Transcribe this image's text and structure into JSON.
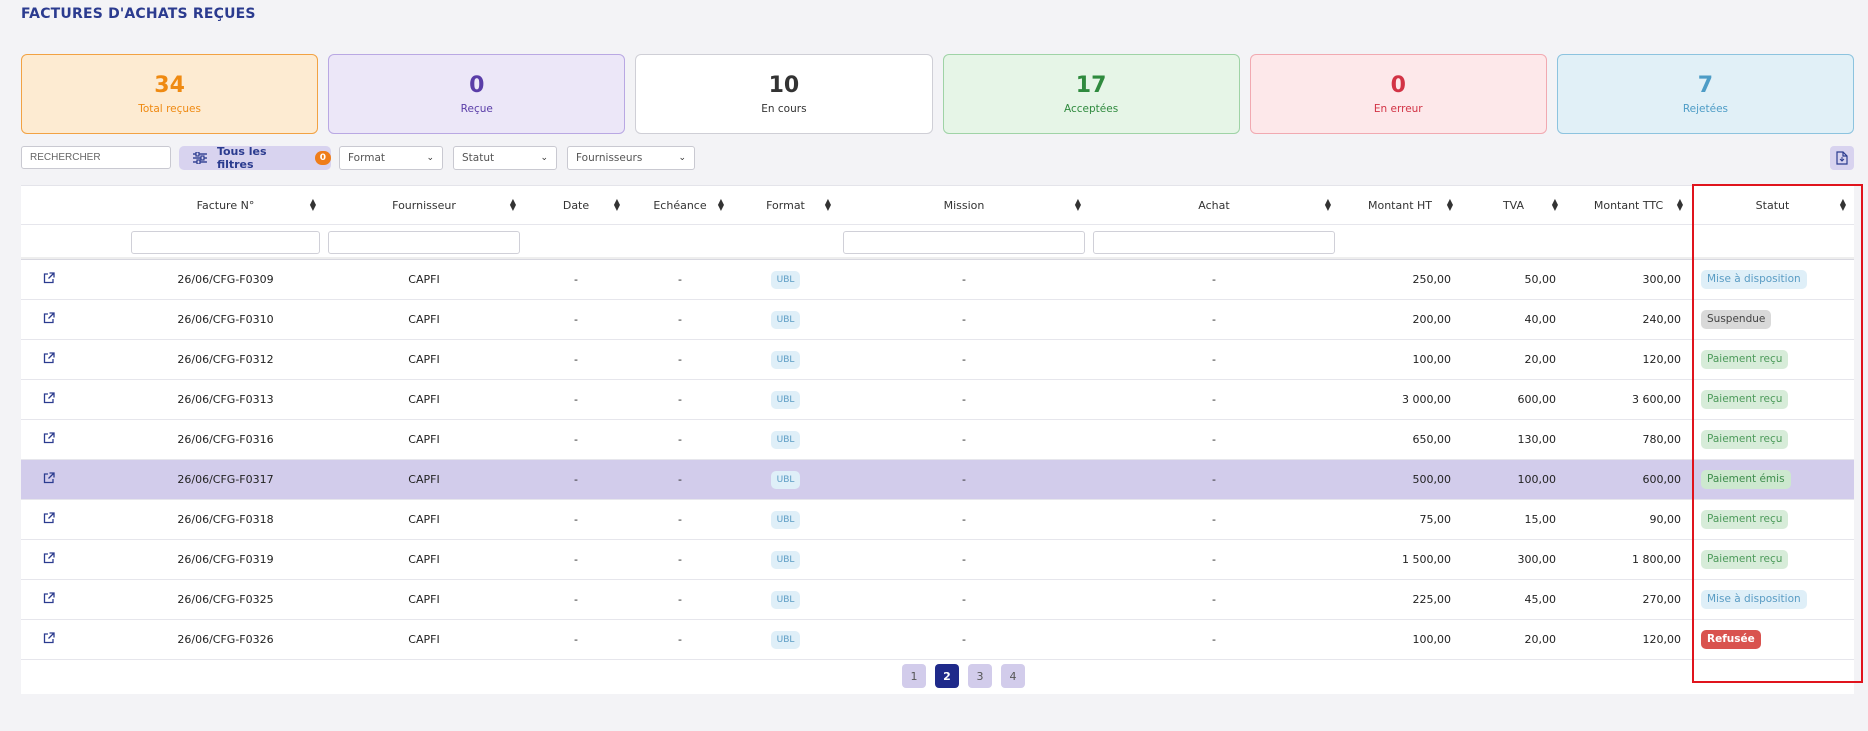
{
  "page": {
    "title": "FACTURES D'ACHATS REÇUES"
  },
  "cards": [
    {
      "value": "34",
      "label": "Total reçues",
      "color": "#ef8a12",
      "bg": "#fdebd2",
      "border": "#f2a243"
    },
    {
      "value": "0",
      "label": "Reçue",
      "color": "#5a3da8",
      "bg": "#ece7f8",
      "border": "#b9a8e3"
    },
    {
      "value": "10",
      "label": "En cours",
      "color": "#333333",
      "bg": "#ffffff",
      "border": "#cfcfd6"
    },
    {
      "value": "17",
      "label": "Acceptées",
      "color": "#2f8a3e",
      "bg": "#e6f5e7",
      "border": "#9fd3a6"
    },
    {
      "value": "0",
      "label": "En erreur",
      "color": "#d23345",
      "bg": "#fde8ea",
      "border": "#f1a9b1"
    },
    {
      "value": "7",
      "label": "Rejetées",
      "color": "#4d9cc6",
      "bg": "#e1f0f7",
      "border": "#8cc3df"
    }
  ],
  "toolbar": {
    "search_placeholder": "RECHERCHER",
    "filters_label": "Tous les filtres",
    "filters_count": "0",
    "format_label": "Format",
    "statut_label": "Statut",
    "fournisseurs_label": "Fournisseurs",
    "export_icon": "file-export-icon"
  },
  "table": {
    "columns": [
      "",
      "Facture N°",
      "Fournisseur",
      "Date",
      "Echéance",
      "Format",
      "Mission",
      "Achat",
      "Montant HT",
      "TVA",
      "Montant TTC",
      "Statut"
    ],
    "rows": [
      {
        "facture": "26/06/CFG-F0309",
        "fournisseur": "CAPFI",
        "date": "-",
        "echeance": "-",
        "format": "UBL",
        "mission": "-",
        "achat": "-",
        "ht": "250,00",
        "tva": "50,00",
        "ttc": "300,00",
        "statut": "Mise à disposition",
        "statut_class": "st-mise"
      },
      {
        "facture": "26/06/CFG-F0310",
        "fournisseur": "CAPFI",
        "date": "-",
        "echeance": "-",
        "format": "UBL",
        "mission": "-",
        "achat": "-",
        "ht": "200,00",
        "tva": "40,00",
        "ttc": "240,00",
        "statut": "Suspendue",
        "statut_class": "st-susp"
      },
      {
        "facture": "26/06/CFG-F0312",
        "fournisseur": "CAPFI",
        "date": "-",
        "echeance": "-",
        "format": "UBL",
        "mission": "-",
        "achat": "-",
        "ht": "100,00",
        "tva": "20,00",
        "ttc": "120,00",
        "statut": "Paiement reçu",
        "statut_class": "st-recu"
      },
      {
        "facture": "26/06/CFG-F0313",
        "fournisseur": "CAPFI",
        "date": "-",
        "echeance": "-",
        "format": "UBL",
        "mission": "-",
        "achat": "-",
        "ht": "3 000,00",
        "tva": "600,00",
        "ttc": "3 600,00",
        "statut": "Paiement reçu",
        "statut_class": "st-recu"
      },
      {
        "facture": "26/06/CFG-F0316",
        "fournisseur": "CAPFI",
        "date": "-",
        "echeance": "-",
        "format": "UBL",
        "mission": "-",
        "achat": "-",
        "ht": "650,00",
        "tva": "130,00",
        "ttc": "780,00",
        "statut": "Paiement reçu",
        "statut_class": "st-recu"
      },
      {
        "facture": "26/06/CFG-F0317",
        "fournisseur": "CAPFI",
        "date": "-",
        "echeance": "-",
        "format": "UBL",
        "mission": "-",
        "achat": "-",
        "ht": "500,00",
        "tva": "100,00",
        "ttc": "600,00",
        "statut": "Paiement émis",
        "statut_class": "st-emis",
        "selected": true
      },
      {
        "facture": "26/06/CFG-F0318",
        "fournisseur": "CAPFI",
        "date": "-",
        "echeance": "-",
        "format": "UBL",
        "mission": "-",
        "achat": "-",
        "ht": "75,00",
        "tva": "15,00",
        "ttc": "90,00",
        "statut": "Paiement reçu",
        "statut_class": "st-recu"
      },
      {
        "facture": "26/06/CFG-F0319",
        "fournisseur": "CAPFI",
        "date": "-",
        "echeance": "-",
        "format": "UBL",
        "mission": "-",
        "achat": "-",
        "ht": "1 500,00",
        "tva": "300,00",
        "ttc": "1 800,00",
        "statut": "Paiement reçu",
        "statut_class": "st-recu"
      },
      {
        "facture": "26/06/CFG-F0325",
        "fournisseur": "CAPFI",
        "date": "-",
        "echeance": "-",
        "format": "UBL",
        "mission": "-",
        "achat": "-",
        "ht": "225,00",
        "tva": "45,00",
        "ttc": "270,00",
        "statut": "Mise à disposition",
        "statut_class": "st-mise"
      },
      {
        "facture": "26/06/CFG-F0326",
        "fournisseur": "CAPFI",
        "date": "-",
        "echeance": "-",
        "format": "UBL",
        "mission": "-",
        "achat": "-",
        "ht": "100,00",
        "tva": "20,00",
        "ttc": "120,00",
        "statut": "Refusée",
        "statut_class": "st-ref"
      }
    ]
  },
  "pagination": {
    "pages": [
      "1",
      "2",
      "3",
      "4"
    ],
    "active": "2"
  }
}
